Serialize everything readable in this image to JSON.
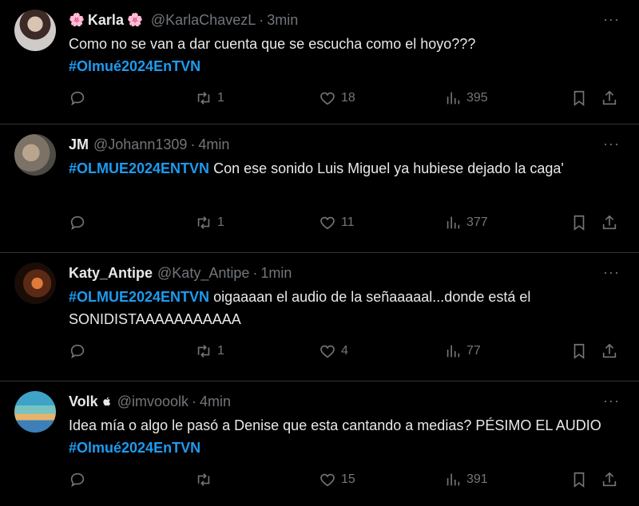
{
  "tweets": [
    {
      "name": "Karla",
      "name_prefix": "🌸",
      "name_suffix": "🌸",
      "handle": "@KarlaChavezL",
      "time": "3min",
      "text_before": "Como no se van a dar cuenta que se escucha como el hoyo???",
      "hashtag": "#Olmué2024EnTVN",
      "text_after": "",
      "retweets": "1",
      "likes": "18",
      "views": "395"
    },
    {
      "name": "JM",
      "handle": "@Johann1309",
      "time": "4min",
      "hashtag": "#OLMUE2024ENTVN",
      "text_after": " Con ese sonido Luis Miguel ya hubiese dejado la caga'",
      "retweets": "1",
      "likes": "11",
      "views": "377"
    },
    {
      "name": "Katy_Antipe",
      "handle": "@Katy_Antipe",
      "time": "1min",
      "hashtag": "#OLMUE2024ENTVN",
      "text_after": " oigaaaan el audio de la señaaaaal...donde está el SONIDISTAAAAAAAAAAA",
      "retweets": "1",
      "likes": "4",
      "views": "77"
    },
    {
      "name": "Volk",
      "name_suffix": "",
      "handle": "@imvooolk",
      "time": "4min",
      "text_before": "Idea mía o algo le pasó a Denise que esta cantando a medias? PÉSIMO EL AUDIO ",
      "hashtag": "#Olmué2024EnTVN",
      "retweets": "",
      "likes": "15",
      "views": "391"
    }
  ],
  "separator": "·",
  "more_glyph": "···",
  "colors": {
    "link": "#1d9bf0",
    "muted": "#71767b",
    "text": "#e7e9ea",
    "divider": "#2f3336"
  }
}
